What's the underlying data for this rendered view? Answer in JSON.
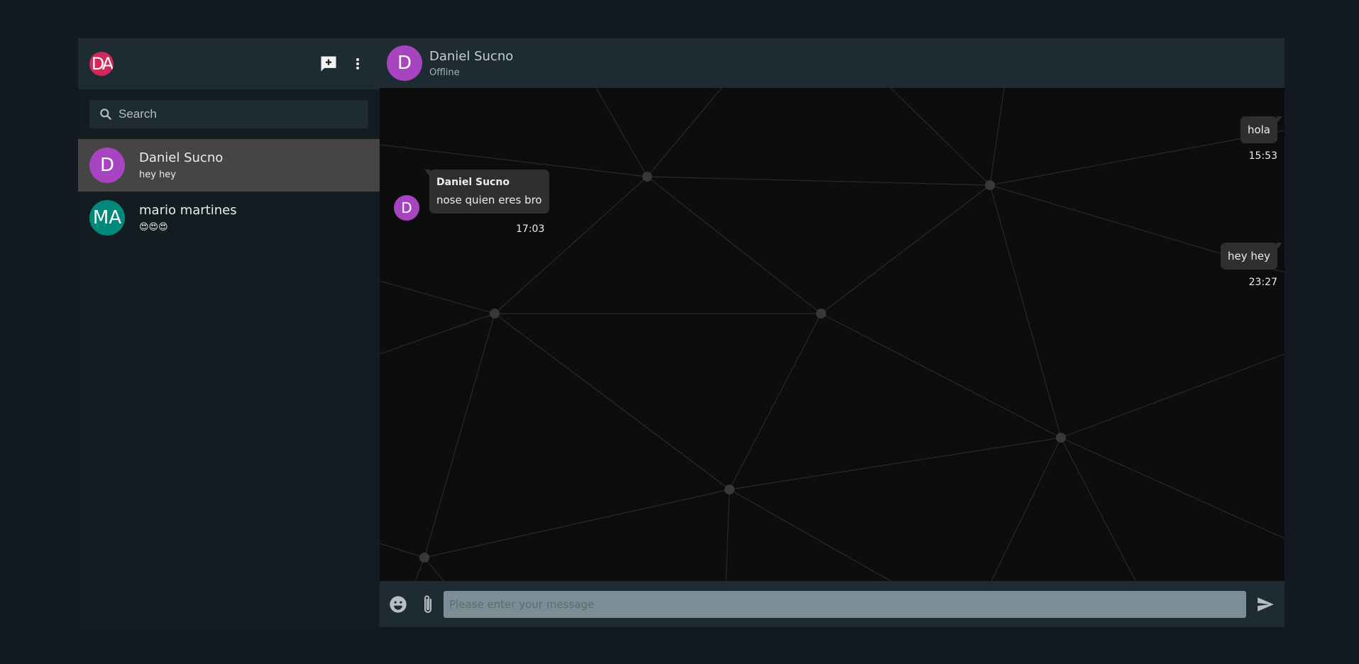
{
  "user": {
    "initials": "DA",
    "avatar_color": "#d1275a"
  },
  "sidebar": {
    "icons": {
      "new_chat": "new-chat-icon",
      "menu": "more-vertical-icon"
    },
    "search": {
      "placeholder": "Search",
      "value": ""
    },
    "chats": [
      {
        "initials": "D",
        "name": "Daniel Sucno",
        "preview": "hey hey",
        "color": "#a944c1",
        "active": true
      },
      {
        "initials": "MA",
        "name": "mario martines",
        "preview": "😍😍😍",
        "color": "#00897b",
        "active": false
      }
    ]
  },
  "chat": {
    "header": {
      "initials": "D",
      "name": "Daniel Sucno",
      "status": "Offline"
    },
    "messages": [
      {
        "direction": "out",
        "text": "hola",
        "time": "15:53"
      },
      {
        "direction": "in",
        "sender": "Daniel Sucno",
        "sender_initials": "D",
        "text": "nose quien eres bro",
        "time": "17:03"
      },
      {
        "direction": "out",
        "text": "hey hey",
        "time": "23:27"
      }
    ],
    "composer": {
      "placeholder": "Please enter your message",
      "value": ""
    }
  },
  "colors": {
    "accent_purple": "#a944c1",
    "accent_teal": "#00897b",
    "panel": "#1e2b33",
    "background": "#121920"
  }
}
